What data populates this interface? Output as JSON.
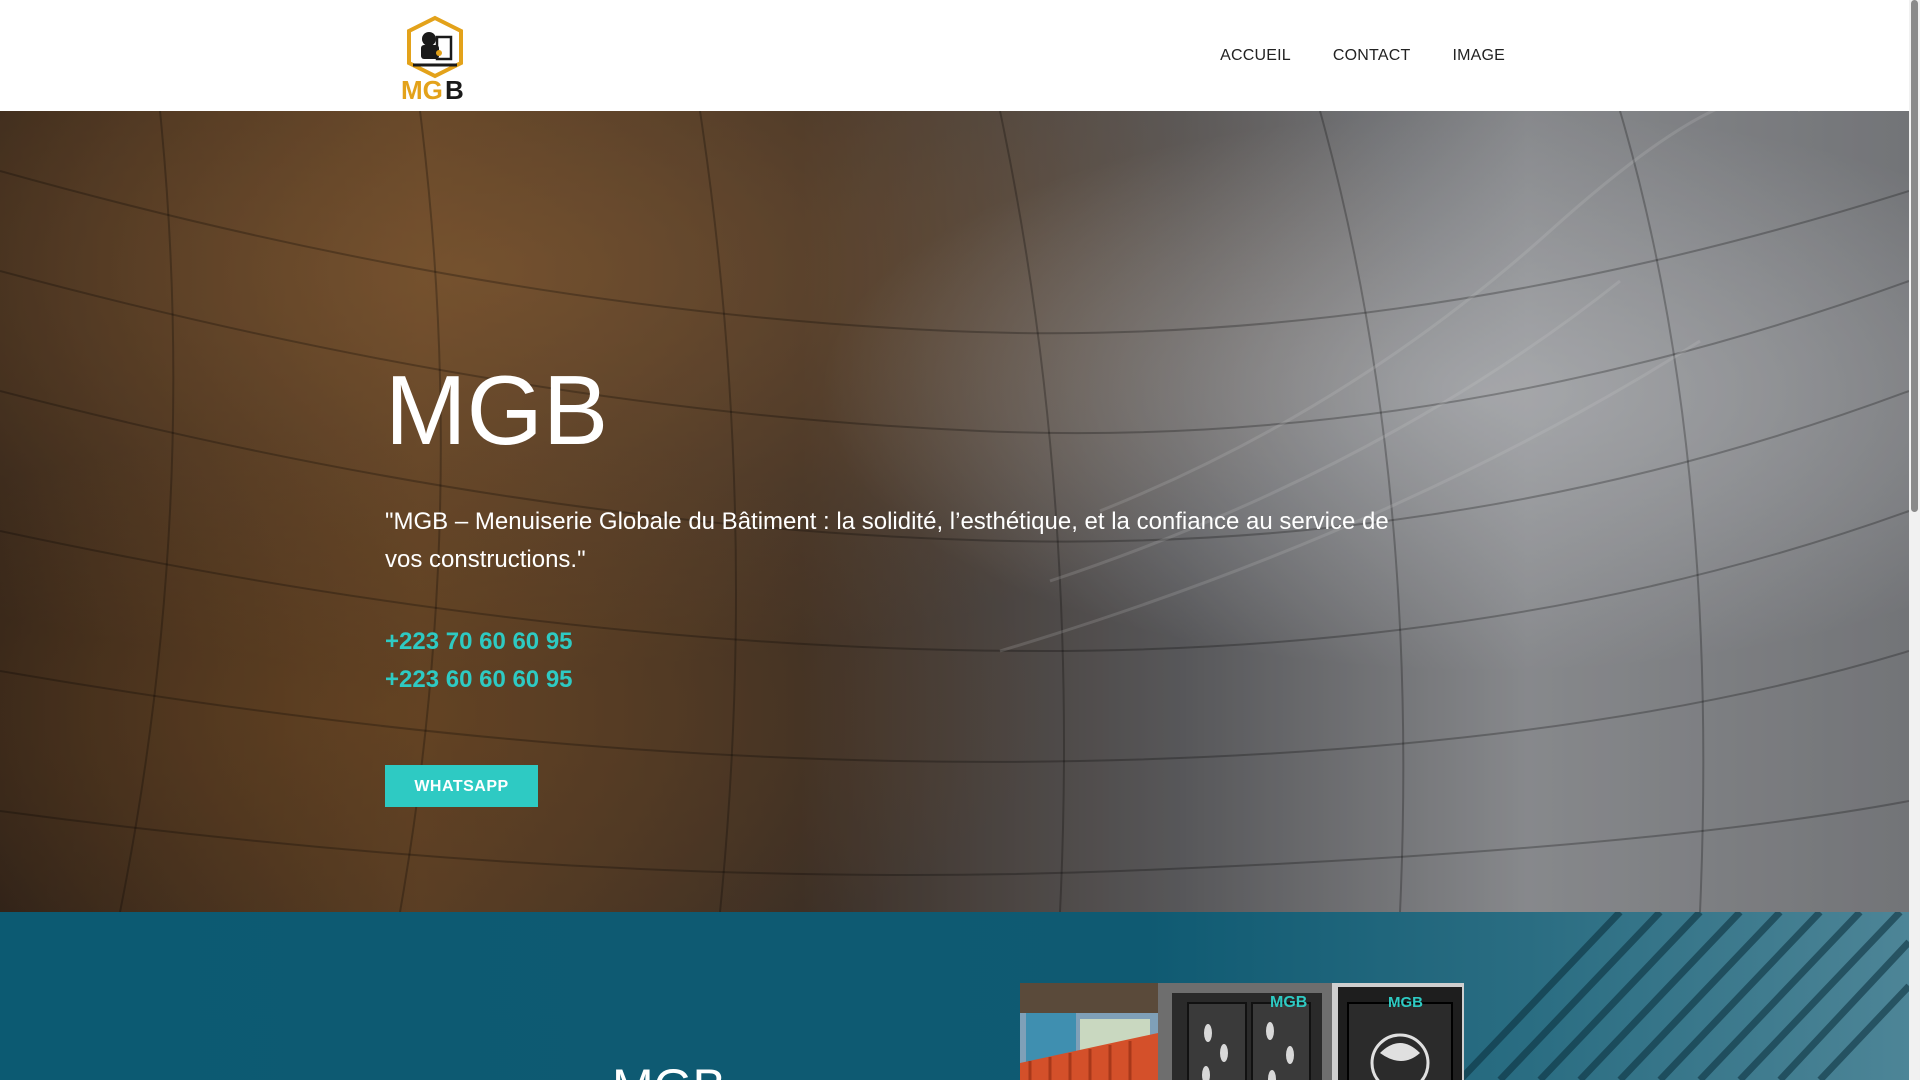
{
  "header": {
    "logo_text": "MGB",
    "nav": [
      {
        "label": "ACCUEIL"
      },
      {
        "label": "CONTACT"
      },
      {
        "label": "IMAGE"
      }
    ]
  },
  "hero": {
    "title": "MGB",
    "tagline": "\"MGB – Menuiserie Globale du Bâtiment : la solidité, l’esthétique, et la confiance au service de vos constructions.\"",
    "phones": [
      "+223 70 60 60 95",
      "+223 60 60 60 95"
    ],
    "button_label": "WHATSAPP"
  },
  "section2": {
    "title": "MGB",
    "gallery_logo_text": "MGB"
  },
  "colors": {
    "accent": "#2ecac3",
    "section_blue": "#0f5a72",
    "logo_gold": "#e3a21a",
    "nav_text": "#222222"
  }
}
